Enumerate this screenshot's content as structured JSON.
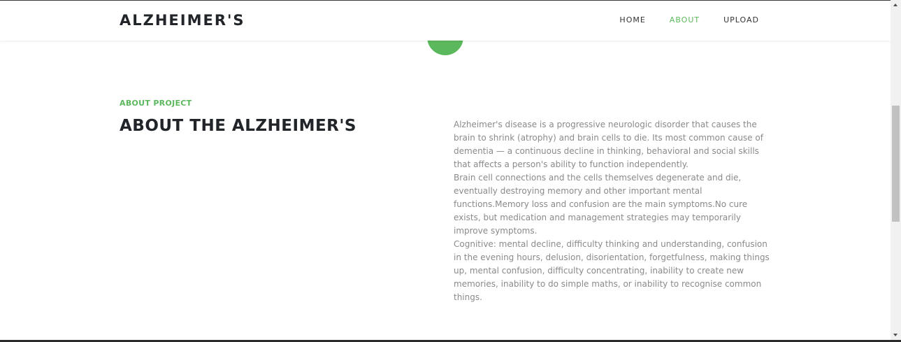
{
  "navbar": {
    "brand": "ALZHEIMER'S",
    "links": [
      {
        "label": "HOME",
        "active": false
      },
      {
        "label": "ABOUT",
        "active": true
      },
      {
        "label": "UPLOAD",
        "active": false
      }
    ]
  },
  "about": {
    "eyebrow": "ABOUT PROJECT",
    "heading": "ABOUT THE ALZHEIMER'S",
    "paragraphs": [
      "Alzheimer's disease is a progressive neurologic disorder that causes the brain to shrink (atrophy) and brain cells to die. Its most common cause of dementia — a continuous decline in thinking, behavioral and social skills that affects a person's ability to function independently.",
      "Brain cell connections and the cells themselves degenerate and die, eventually destroying memory and other important mental functions.Memory loss and confusion are the main symptoms.No cure exists, but medication and management strategies may temporarily improve symptoms.",
      "Cognitive: mental decline, difficulty thinking and understanding, confusion in the evening hours, delusion, disorientation, forgetfulness, making things up, mental confusion, difficulty concentrating, inability to create new memories, inability to do simple maths, or inability to recognise common things."
    ]
  },
  "colors": {
    "accent": "#5cb85c",
    "heading": "#212529",
    "body_text": "#8a8a8a"
  }
}
